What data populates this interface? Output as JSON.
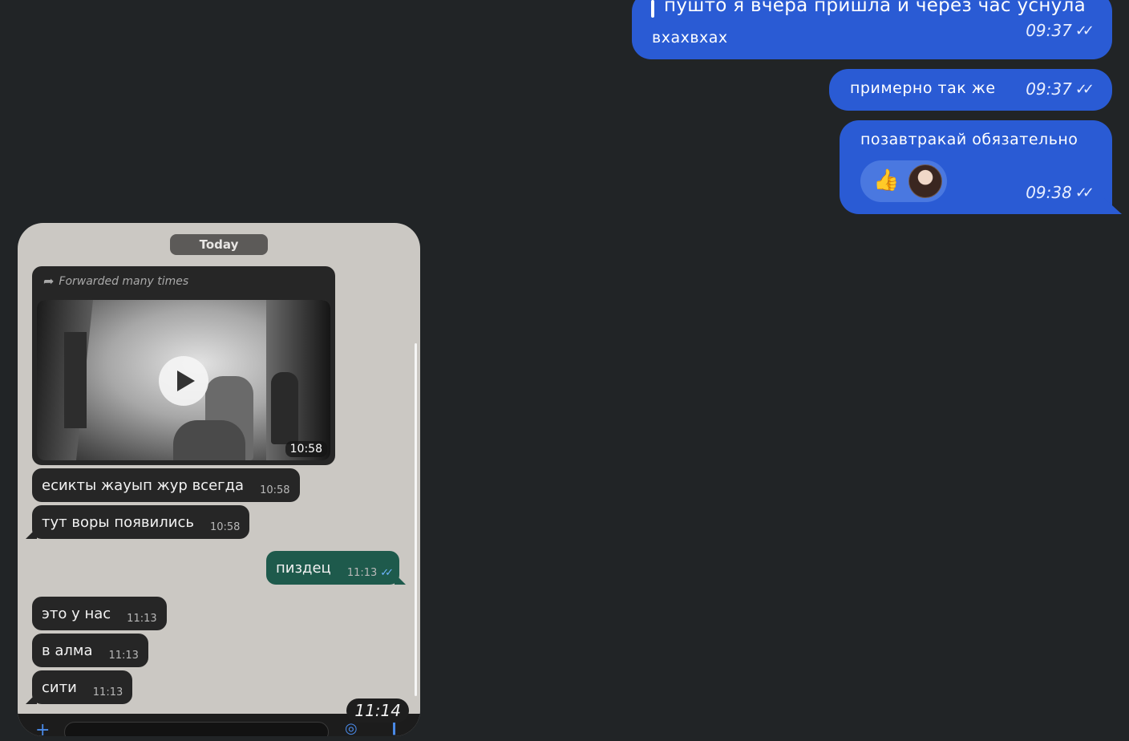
{
  "chat": {
    "messages_out": [
      {
        "quote": "пушто я вчера пришла и через час уснула",
        "text": "вхахвхах",
        "time": "09:37"
      },
      {
        "text": "примерно так же",
        "time": "09:37"
      },
      {
        "text": "позавтракай обязательно",
        "time": "09:38",
        "reaction_emoji": "👍"
      }
    ]
  },
  "icons": {
    "read_checks": "✓✓",
    "thumbs_up": "👍",
    "forward_arrow": "➦",
    "plus": "+",
    "camera": "◎",
    "mic": "❙"
  },
  "screenshot": {
    "date_label": "Today",
    "forwarded_label": "Forwarded many times",
    "video_time": "10:58",
    "incoming": [
      {
        "text": "есикты жауып жур всегда",
        "time": "10:58"
      },
      {
        "text": "тут воры появились",
        "time": "10:58"
      },
      {
        "text": "это у нас",
        "time": "11:13"
      },
      {
        "text": "в алма",
        "time": "11:13"
      },
      {
        "text": "сити",
        "time": "11:13"
      }
    ],
    "outgoing": {
      "text": "пиздец",
      "time": "11:13"
    },
    "overlay_time": "11:14"
  },
  "colors": {
    "background": "#212426",
    "outgoing_bubble": "#2a5bd4",
    "screenshot_bg": "#cbc8c3",
    "wa_outgoing": "#1e5a4c"
  }
}
